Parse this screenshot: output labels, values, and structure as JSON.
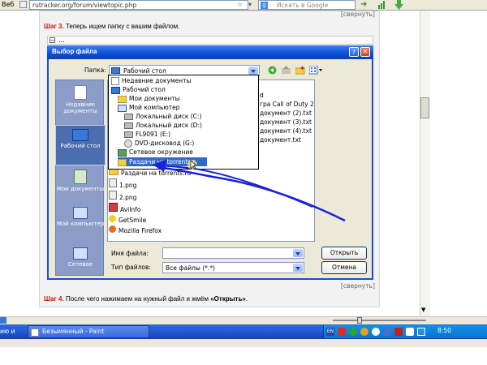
{
  "browser": {
    "left_fragment": "Веб",
    "url_text": "rutracker.org/forum/viewtopic.php",
    "search_placeholder": "Искать в Google"
  },
  "post": {
    "collapse_top": "[свернуть]",
    "step3_label": "Шаг 3.",
    "step3_text": " Теперь ищем папку с вашим файлом.",
    "spoiler_label": "...",
    "collapse_bottom": "[свернуть]",
    "step4_label": "Шаг 4.",
    "step4_text": " После чего нажимаем на нужный файл и жмём ",
    "step4_bold": "«Открыть»",
    "step4_end": "."
  },
  "dialog": {
    "title": "Выбор файла",
    "help": "?",
    "close": "×",
    "folder_label": "Папка:",
    "folder_value": "Рабочий стол",
    "places": [
      {
        "label": "Недавние документы",
        "icon": "recent-docs-icon"
      },
      {
        "label": "Рабочий стол",
        "icon": "desktop-icon"
      },
      {
        "label": "Мои документы",
        "icon": "my-documents-icon"
      },
      {
        "label": "Мой компьютер",
        "icon": "my-computer-icon"
      },
      {
        "label": "Сетевое",
        "icon": "network-icon"
      }
    ],
    "dropdown_items": [
      {
        "label": "Недавние документы",
        "icon": "recent-docs-icon",
        "indent": 0
      },
      {
        "label": "Рабочий стол",
        "icon": "desktop-icon",
        "indent": 0
      },
      {
        "label": "Мои документы",
        "icon": "folder-icon",
        "indent": 1
      },
      {
        "label": "Мой компьютер",
        "icon": "computer-icon",
        "indent": 1
      },
      {
        "label": "Локальный диск (C:)",
        "icon": "drive-icon",
        "indent": 2
      },
      {
        "label": "Локальный диск (D:)",
        "icon": "drive-icon",
        "indent": 2
      },
      {
        "label": "FL9091 (E:)",
        "icon": "drive-icon",
        "indent": 2
      },
      {
        "label": "DVD-дисковод (G:)",
        "icon": "dvd-icon",
        "indent": 2
      },
      {
        "label": "Сетевое окружение",
        "icon": "network-icon",
        "indent": 1
      },
      {
        "label": "Раздачи на torrents.r",
        "icon": "folder-icon",
        "indent": 1
      }
    ],
    "files_partial": [
      "d",
      "гра Call of Duty 2",
      "документ (2).txt",
      "документ (3).txt",
      "документ (4).txt",
      "документ.txt"
    ],
    "files": [
      {
        "label": "Раздачи на torrents.ru",
        "icon": "folder-icon"
      },
      {
        "label": "1.png",
        "icon": "image-icon"
      },
      {
        "label": "2.png",
        "icon": "image-icon"
      },
      {
        "label": "AviInfo",
        "icon": "app-icon"
      },
      {
        "label": "GetSmile",
        "icon": "app-icon"
      },
      {
        "label": "Mozilla Firefox",
        "icon": "firefox-icon"
      }
    ],
    "filename_label": "Имя файла:",
    "filename_value": "",
    "filetype_label": "Тип файлов:",
    "filetype_value": "Все файлы (*.*)",
    "open_button": "Открыть",
    "cancel_button": "Отмена"
  },
  "taskbar": {
    "task_left": "ию и по...",
    "task_paint": "Безымянный - Paint",
    "tray_lang": "EN",
    "clock": "8:50"
  },
  "colors": {
    "accent_red": "#cc1010",
    "xp_blue": "#0d4fd4",
    "selection": "#316ac5",
    "arrow": "#1a22d8"
  }
}
